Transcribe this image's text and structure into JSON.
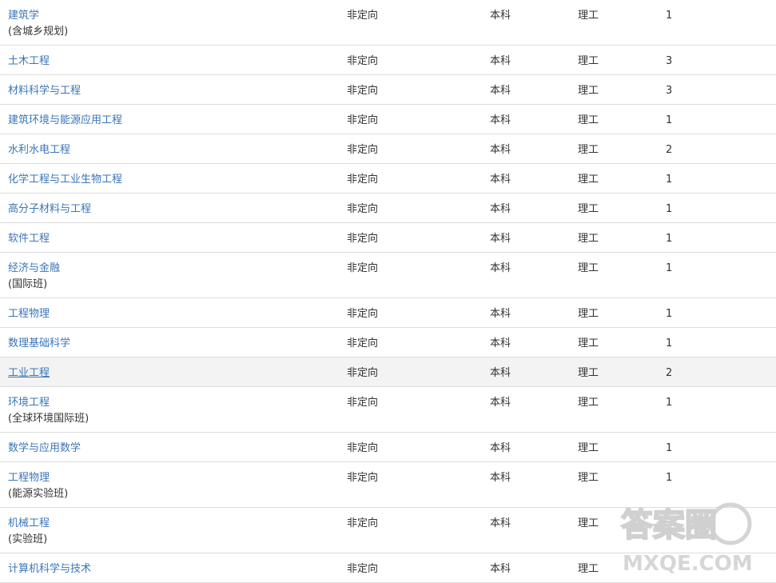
{
  "rows": [
    {
      "major": "建筑学",
      "sub": "(含城乡规划)",
      "direction": "非定向",
      "level": "本科",
      "category": "理工",
      "count": "1"
    },
    {
      "major": "土木工程",
      "sub": "",
      "direction": "非定向",
      "level": "本科",
      "category": "理工",
      "count": "3"
    },
    {
      "major": "材料科学与工程",
      "sub": "",
      "direction": "非定向",
      "level": "本科",
      "category": "理工",
      "count": "3"
    },
    {
      "major": "建筑环境与能源应用工程",
      "sub": "",
      "direction": "非定向",
      "level": "本科",
      "category": "理工",
      "count": "1"
    },
    {
      "major": "水利水电工程",
      "sub": "",
      "direction": "非定向",
      "level": "本科",
      "category": "理工",
      "count": "2"
    },
    {
      "major": "化学工程与工业生物工程",
      "sub": "",
      "direction": "非定向",
      "level": "本科",
      "category": "理工",
      "count": "1"
    },
    {
      "major": "高分子材料与工程",
      "sub": "",
      "direction": "非定向",
      "level": "本科",
      "category": "理工",
      "count": "1"
    },
    {
      "major": "软件工程",
      "sub": "",
      "direction": "非定向",
      "level": "本科",
      "category": "理工",
      "count": "1"
    },
    {
      "major": "经济与金融",
      "sub": "(国际班)",
      "direction": "非定向",
      "level": "本科",
      "category": "理工",
      "count": "1"
    },
    {
      "major": "工程物理",
      "sub": "",
      "direction": "非定向",
      "level": "本科",
      "category": "理工",
      "count": "1"
    },
    {
      "major": "数理基础科学",
      "sub": "",
      "direction": "非定向",
      "level": "本科",
      "category": "理工",
      "count": "1"
    },
    {
      "major": "工业工程",
      "sub": "",
      "direction": "非定向",
      "level": "本科",
      "category": "理工",
      "count": "2"
    },
    {
      "major": "环境工程",
      "sub": "(全球环境国际班)",
      "direction": "非定向",
      "level": "本科",
      "category": "理工",
      "count": "1"
    },
    {
      "major": "数学与应用数学",
      "sub": "",
      "direction": "非定向",
      "level": "本科",
      "category": "理工",
      "count": "1"
    },
    {
      "major": "工程物理",
      "sub": "(能源实验班)",
      "direction": "非定向",
      "level": "本科",
      "category": "理工",
      "count": "1"
    },
    {
      "major": "机械工程",
      "sub": "(实验班)",
      "direction": "非定向",
      "level": "本科",
      "category": "理工",
      "count": ""
    },
    {
      "major": "计算机科学与技术",
      "sub": "",
      "direction": "非定向",
      "level": "本科",
      "category": "理工",
      "count": ""
    }
  ],
  "highlighted_row": 11,
  "watermark": {
    "text": "答案圈",
    "url": "MXQE.COM"
  }
}
